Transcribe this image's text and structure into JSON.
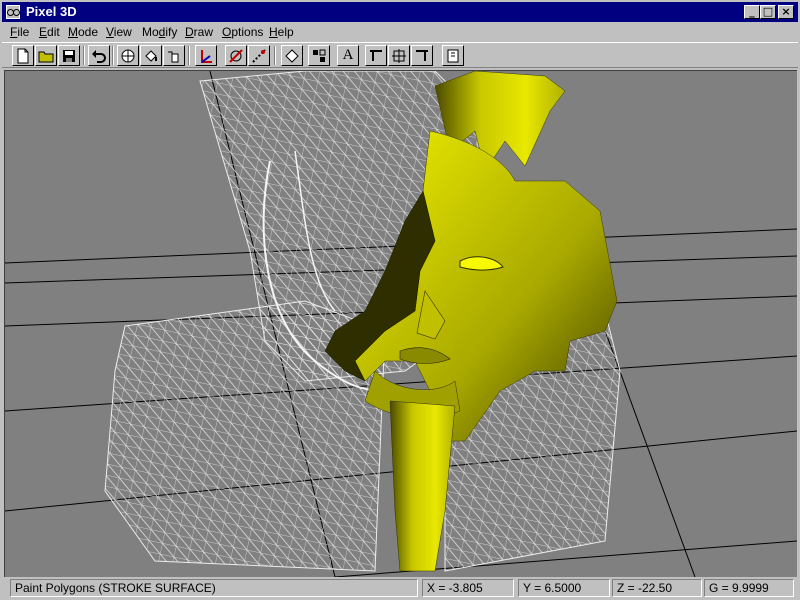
{
  "window": {
    "title": "Pixel 3D"
  },
  "menu": [
    {
      "key": "F",
      "rest": "ile"
    },
    {
      "key": "E",
      "rest": "dit"
    },
    {
      "key": "M",
      "rest": "ode"
    },
    {
      "key": "V",
      "rest": "iew"
    },
    {
      "pre": "Mo",
      "key": "d",
      "rest": "ify"
    },
    {
      "key": "D",
      "rest": "raw"
    },
    {
      "key": "O",
      "rest": "ptions"
    },
    {
      "key": "H",
      "rest": "elp"
    }
  ],
  "toolbar": {
    "text_tool_glyph": "A"
  },
  "status": {
    "message": "Paint Polygons (STROKE SURFACE)",
    "x": "X = -3.805",
    "y": "Y = 6.5000",
    "z": "Z = -22.50",
    "g": "G = 9.9999"
  },
  "colors": {
    "surface": "#d8d800",
    "wireframe": "#ffffff",
    "grid": "#000000",
    "background": "#808080"
  }
}
